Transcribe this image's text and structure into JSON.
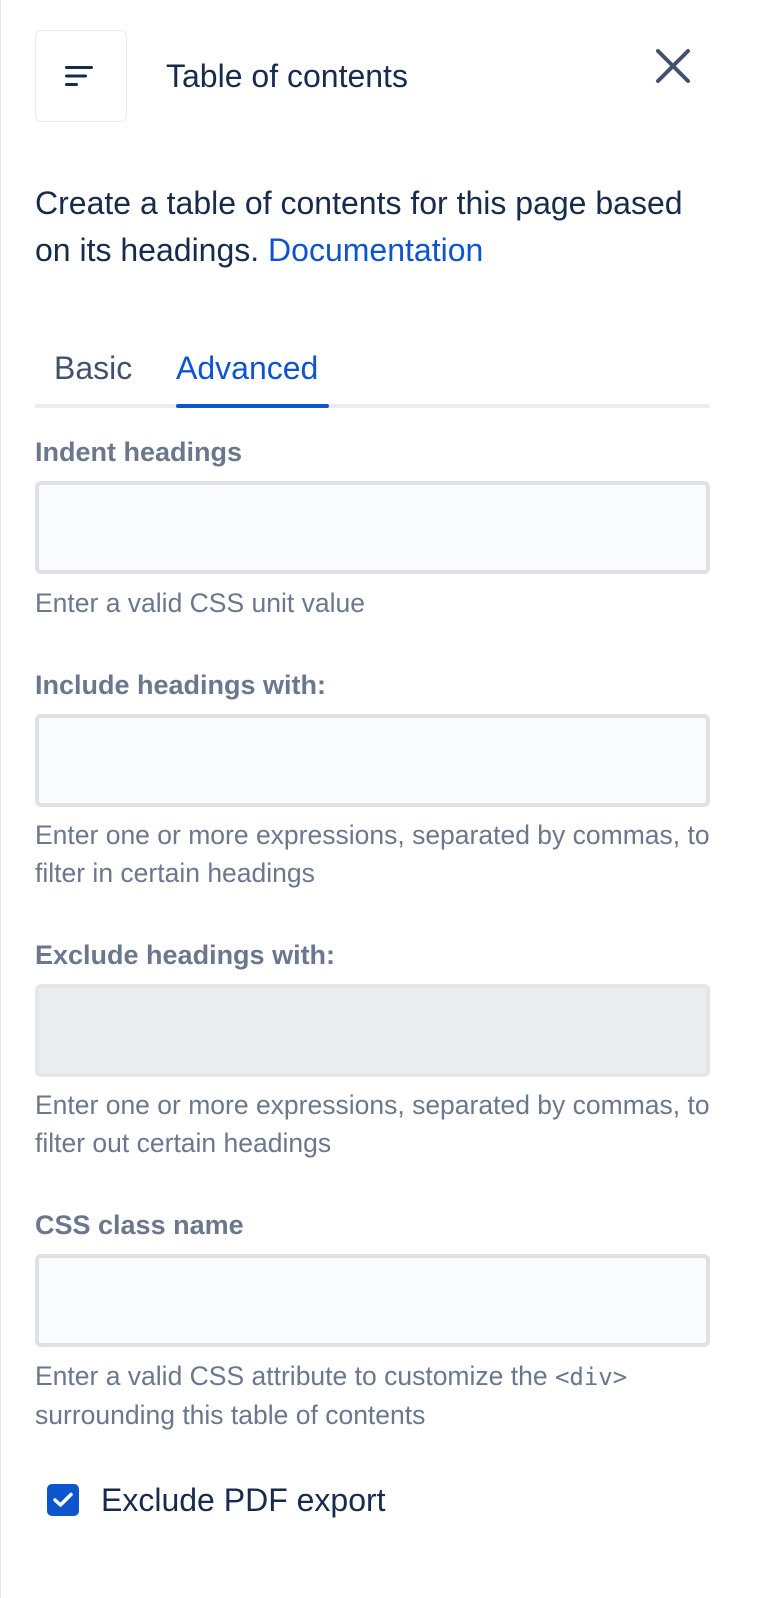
{
  "header": {
    "icon": "toc-lines-icon",
    "title": "Table of contents",
    "close_icon": "close-icon"
  },
  "description": {
    "text": "Create a table of contents for this page based on its headings.",
    "link": "Documentation"
  },
  "tabs": [
    {
      "label": "Basic",
      "active": false
    },
    {
      "label": "Advanced",
      "active": true
    }
  ],
  "fields": {
    "indent": {
      "label": "Indent headings",
      "value": "",
      "help": "Enter a valid CSS unit value"
    },
    "include": {
      "label": "Include headings with:",
      "value": "",
      "help": "Enter one or more expressions, separated by commas, to filter in certain headings"
    },
    "exclude": {
      "label": "Exclude headings with:",
      "value": "",
      "disabled": true,
      "help": "Enter one or more expressions, separated by commas, to filter out certain headings"
    },
    "css_class": {
      "label": "CSS class name",
      "value": "",
      "help_before": "Enter a valid CSS attribute to customize the ",
      "help_code": "<div>",
      "help_after": " surrounding this table of contents"
    }
  },
  "exclude_pdf": {
    "label": "Exclude PDF export",
    "checked": true
  },
  "colors": {
    "accent": "#0c55cf",
    "text": "#172b4d",
    "muted": "#6b778c"
  }
}
